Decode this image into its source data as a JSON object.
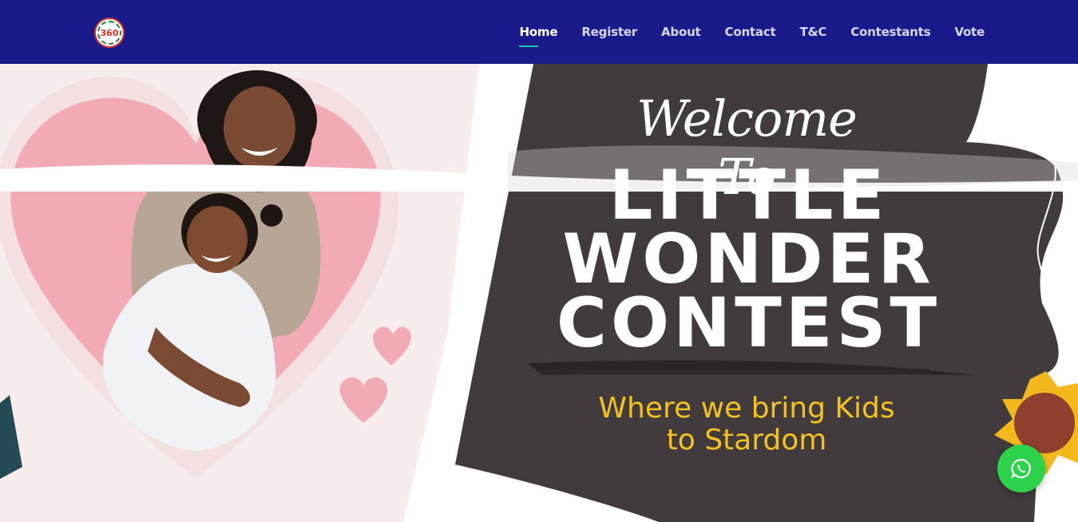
{
  "header": {
    "logo_text": "360",
    "nav": [
      {
        "label": "Home",
        "active": true
      },
      {
        "label": "Register",
        "active": false
      },
      {
        "label": "About",
        "active": false
      },
      {
        "label": "Contact",
        "active": false
      },
      {
        "label": "T&C",
        "active": false
      },
      {
        "label": "Contestants",
        "active": false
      },
      {
        "label": "Vote",
        "active": false
      }
    ]
  },
  "hero": {
    "welcome": "Welcome To",
    "title_lines": [
      "LITTLE",
      "WONDER",
      "CONTEST"
    ],
    "tagline_line1": "Where we bring Kids",
    "tagline_line2": "to Stardom"
  },
  "floating": {
    "whatsapp_icon": "whatsapp-icon"
  },
  "colors": {
    "navbar": "#1a1a8c",
    "active_underline": "#23c4a8",
    "dark_panel": "#423b3e",
    "heart_pink": "#f2aab4",
    "tagline_yellow": "#f3c21f",
    "whatsapp_green": "#2bd24a",
    "sun_yellow": "#f2b81c",
    "sun_center": "#8e3f2d"
  }
}
